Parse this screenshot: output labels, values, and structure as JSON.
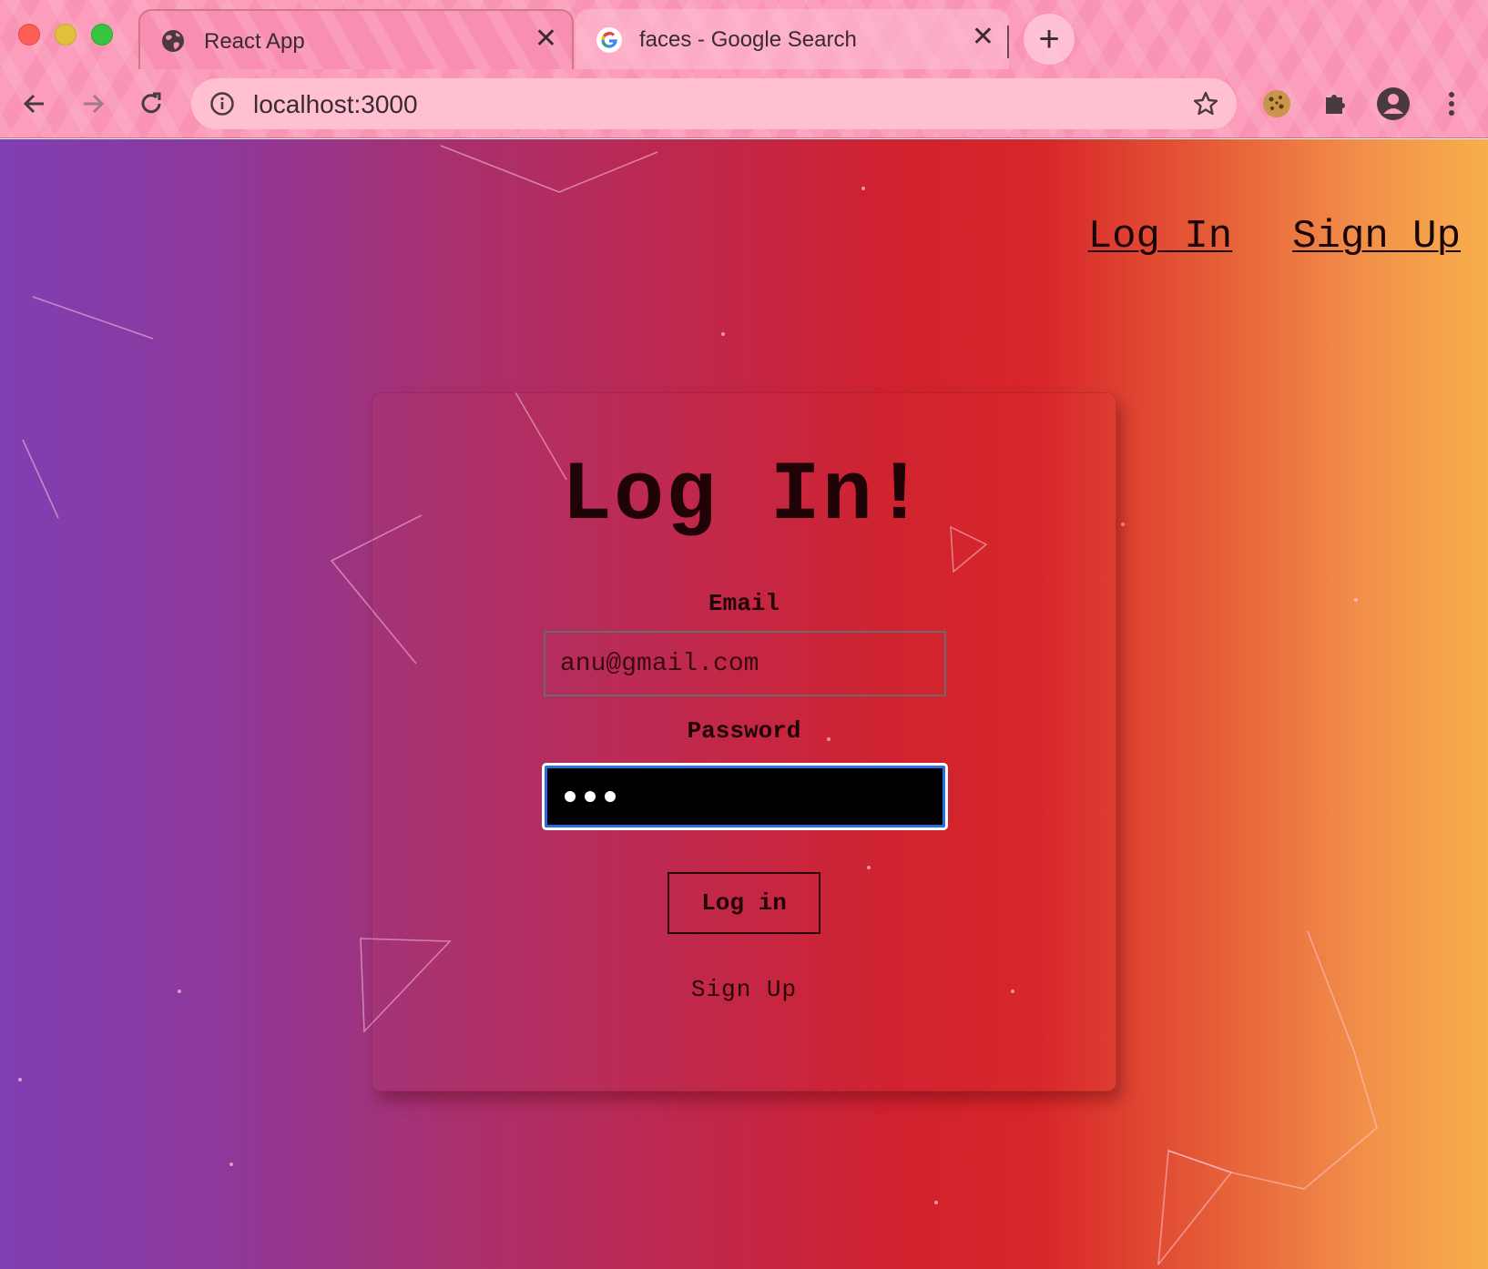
{
  "browser": {
    "tabs": [
      {
        "title": "React App",
        "favicon": "globe-icon",
        "active": true
      },
      {
        "title": "faces - Google Search",
        "favicon": "google-g-icon",
        "active": false
      }
    ],
    "url": "localhost:3000"
  },
  "nav": {
    "login_label": "Log In",
    "signup_label": "Sign Up"
  },
  "form": {
    "title": "Log In!",
    "email_label": "Email",
    "email_value": "anu@gmail.com",
    "password_label": "Password",
    "password_masked_count": 3,
    "submit_label": "Log in",
    "signup_link": "Sign Up"
  },
  "colors": {
    "gradient_start": "#7f3fb3",
    "gradient_mid": "#d8262a",
    "gradient_end": "#f8ae4b",
    "focus_ring": "#2a6fe0"
  }
}
